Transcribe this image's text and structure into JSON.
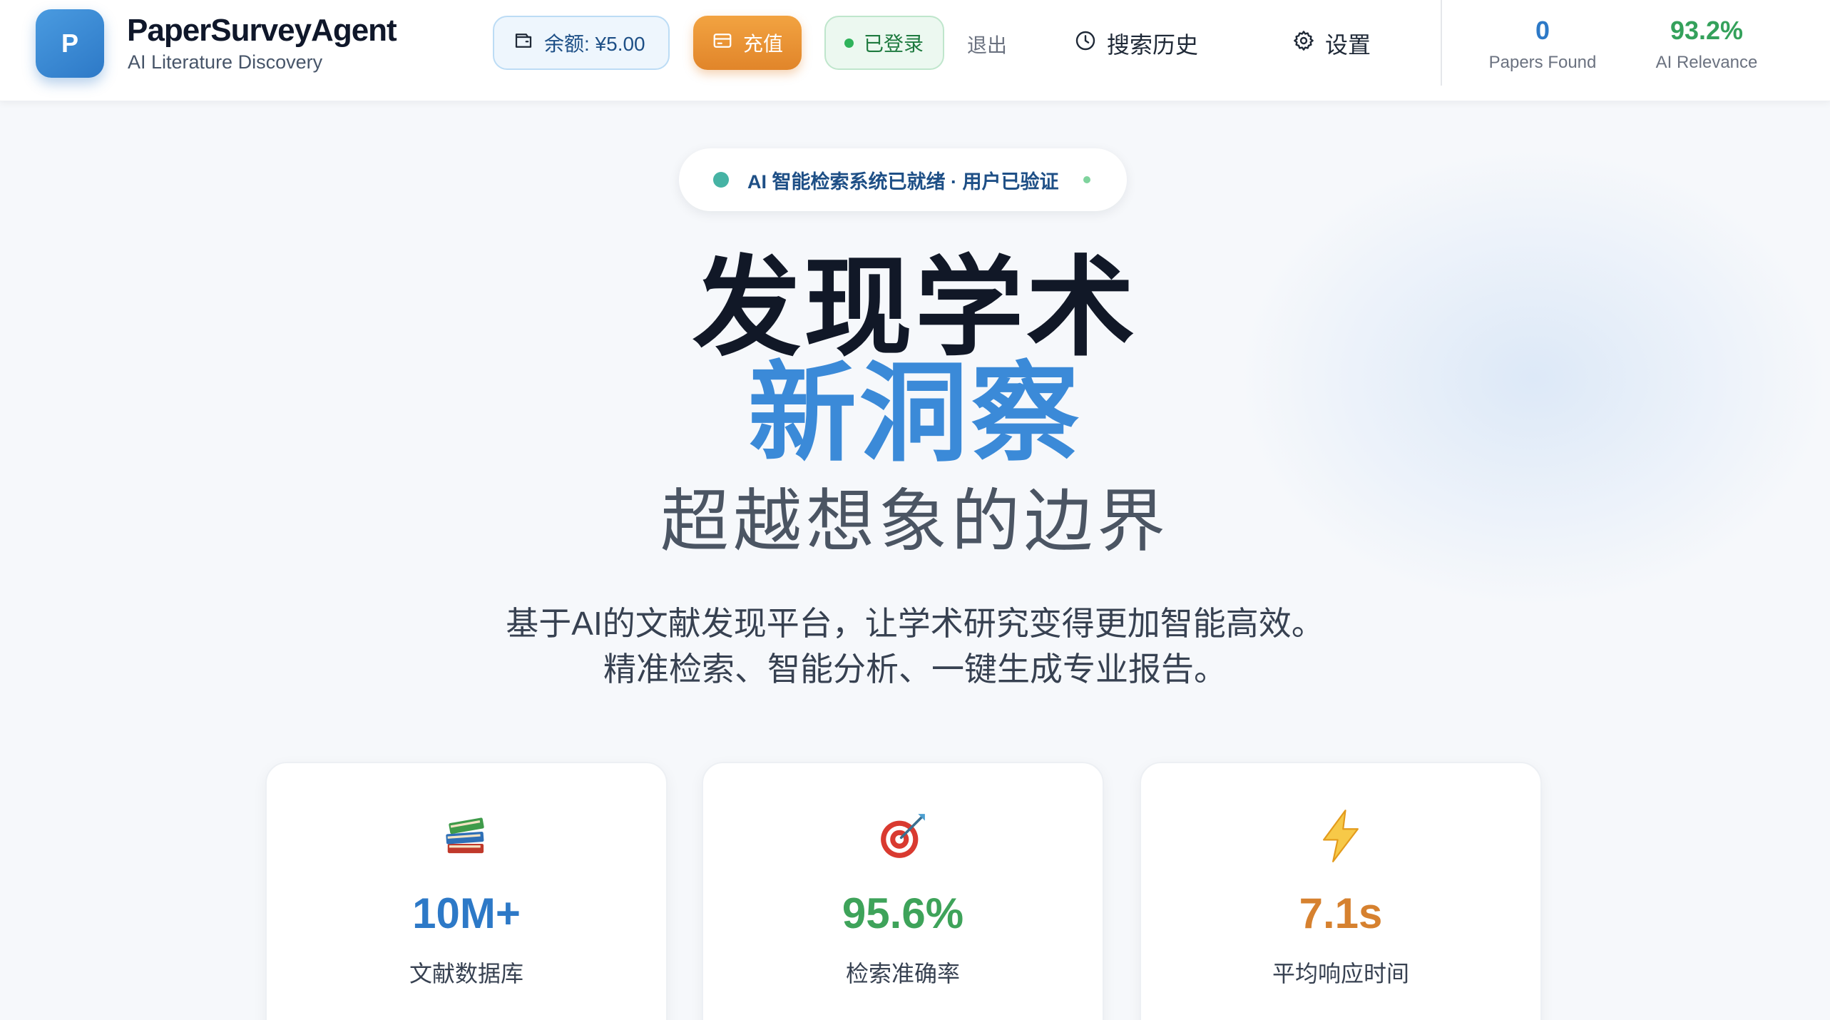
{
  "brand": {
    "logo_letter": "P",
    "title": "PaperSurveyAgent",
    "subtitle": "AI Literature Discovery"
  },
  "header": {
    "balance_label": "余额: ¥5.00",
    "recharge_label": "充值",
    "login_status": "已登录",
    "logout_label": "退出",
    "history_label": "搜索历史",
    "settings_label": "设置",
    "stats": [
      {
        "value": "0",
        "label": "Papers Found"
      },
      {
        "value": "93.2%",
        "label": "AI Relevance"
      }
    ]
  },
  "status_badge": {
    "text": "AI 智能检索系统已就绪 · 用户已验证"
  },
  "hero": {
    "line1": "发现学术",
    "line2": "新洞察",
    "line3": "超越想象的边界",
    "desc_line1": "基于AI的文献发现平台，让学术研究变得更加智能高效。",
    "desc_line2": "精准检索、智能分析、一键生成专业报告。"
  },
  "cards": [
    {
      "icon": "books-icon",
      "value": "10M+",
      "label": "文献数据库"
    },
    {
      "icon": "target-icon",
      "value": "95.6%",
      "label": "检索准确率"
    },
    {
      "icon": "lightning-icon",
      "value": "7.1s",
      "label": "平均响应时间"
    }
  ],
  "colors": {
    "accent_blue": "#3b8ad8",
    "accent_green": "#3ea35a",
    "accent_orange": "#d6812f",
    "recharge_orange": "#e1852a"
  }
}
